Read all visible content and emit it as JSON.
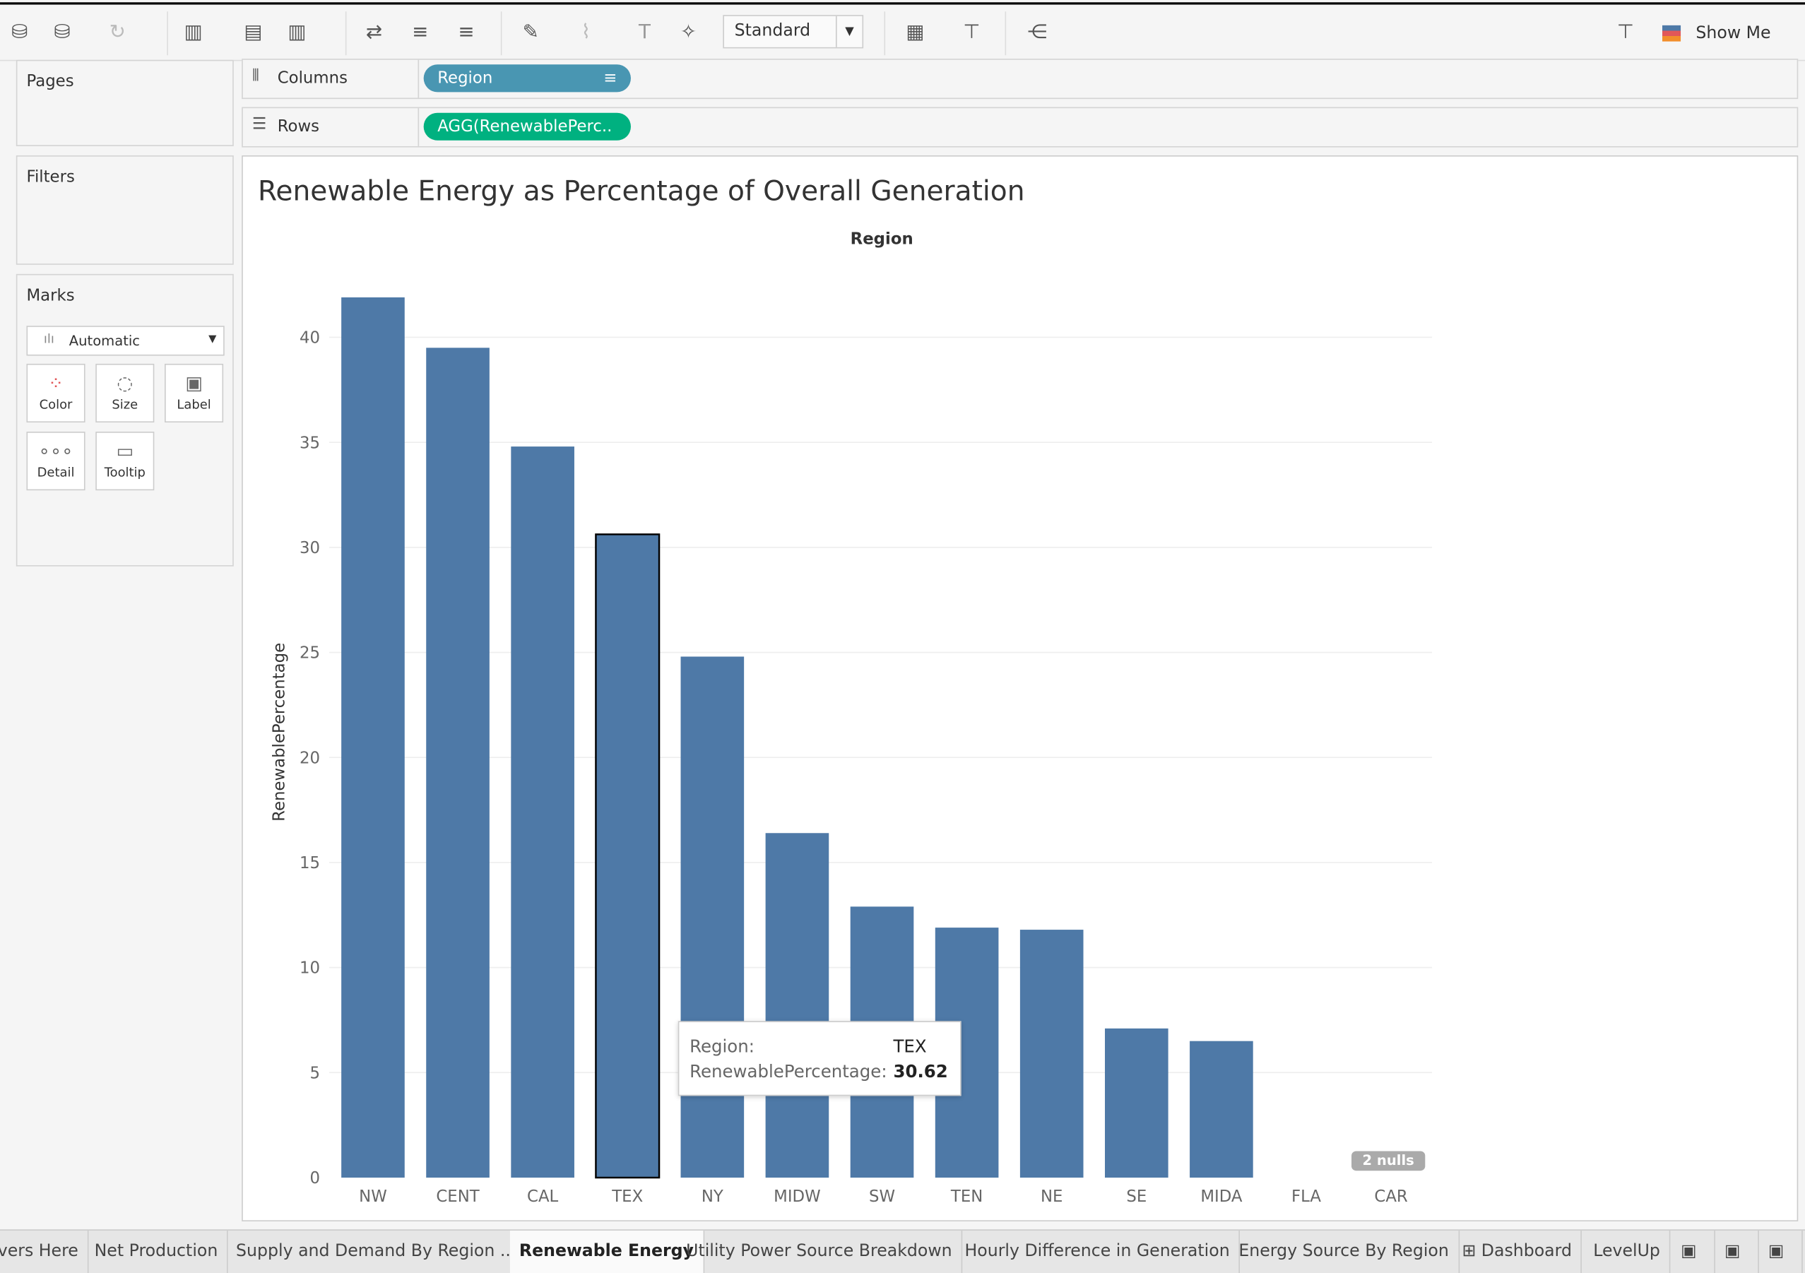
{
  "toolbar": {
    "mark_size_select": "Standard",
    "show_me": "Show Me"
  },
  "left": {
    "pages": "Pages",
    "filters": "Filters",
    "marks": "Marks",
    "mark_type": "Automatic",
    "cards": [
      {
        "label": "Color",
        "icon": "color-icon"
      },
      {
        "label": "Size",
        "icon": "size-icon"
      },
      {
        "label": "Label",
        "icon": "label-icon"
      },
      {
        "label": "Detail",
        "icon": "detail-icon"
      },
      {
        "label": "Tooltip",
        "icon": "tooltip-icon"
      }
    ]
  },
  "shelves": {
    "columns_label": "Columns",
    "columns_pill": "Region",
    "rows_label": "Rows",
    "rows_pill": "AGG(RenewablePerc..",
    "columns_color": "#4996b2",
    "rows_color": "#00b180"
  },
  "view": {
    "title": "Renewable Energy as Percentage of Overall Generation",
    "nulls_badge": "2 nulls",
    "tooltip": {
      "k1": "Region:",
      "v1": "TEX",
      "k2": "RenewablePercentage:",
      "v2": "30.62"
    }
  },
  "chart_data": {
    "type": "bar",
    "xlabel": "Region",
    "ylabel": "RenewablePercentage",
    "bar_color": "#4e79a7",
    "categories": [
      "NW",
      "CENT",
      "CAL",
      "TEX",
      "NY",
      "MIDW",
      "SW",
      "TEN",
      "NE",
      "SE",
      "MIDA",
      "FLA",
      "CAR"
    ],
    "values": [
      41.9,
      39.5,
      34.8,
      30.62,
      24.8,
      16.4,
      12.9,
      11.9,
      11.8,
      7.1,
      6.5,
      null,
      null
    ],
    "yticks": [
      0,
      5,
      10,
      15,
      20,
      25,
      30,
      35,
      40
    ],
    "ylim": [
      0,
      44
    ],
    "grid": true,
    "selected": "TEX"
  },
  "tabs": [
    "vers Here",
    "Net Production",
    "Supply and Demand By Region ...",
    "Renewable Energy",
    "Utility Power Source Breakdown",
    "Hourly Difference in Generation",
    "Energy Source By Region",
    "Dashboard",
    "LevelUp"
  ],
  "active_tab": "Renewable Energy"
}
